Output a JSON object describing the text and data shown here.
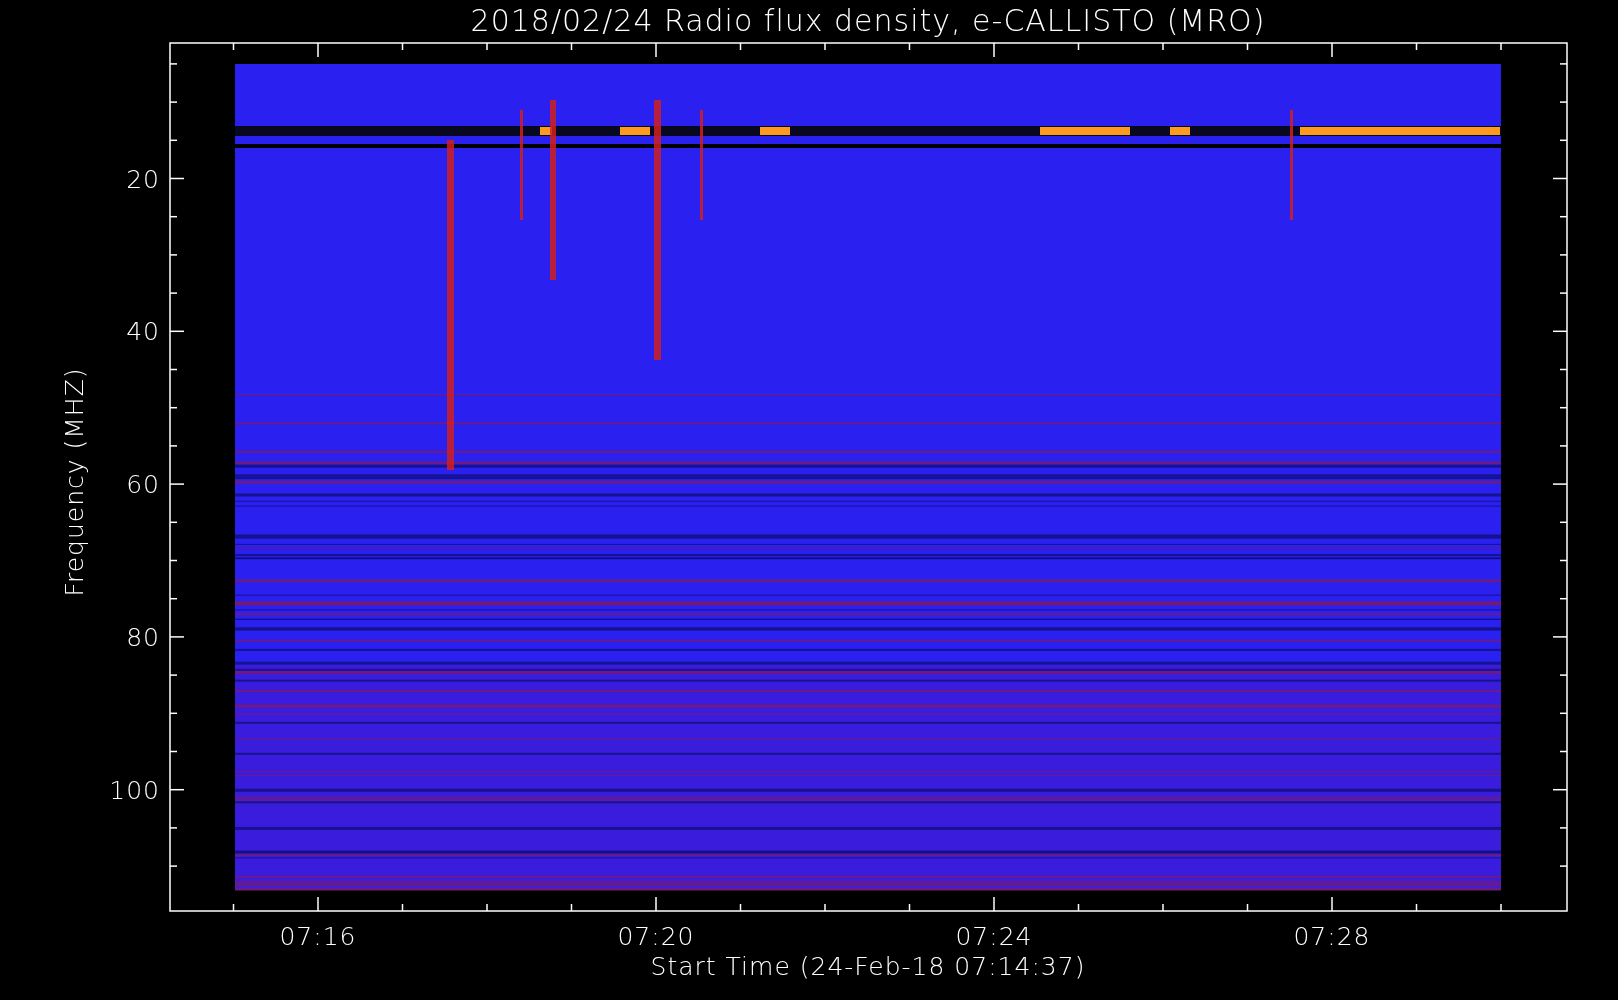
{
  "title": "2018/02/24  Radio flux density, e-CALLISTO (MRO)",
  "y_axis": {
    "label": "Frequency (MHZ)",
    "tick_labels": [
      "20",
      "40",
      "60",
      "80",
      "100"
    ]
  },
  "x_axis": {
    "label": "Start Time (24-Feb-18 07:14:37)",
    "tick_labels": [
      "07:16",
      "07:20",
      "07:24",
      "07:28"
    ]
  }
}
